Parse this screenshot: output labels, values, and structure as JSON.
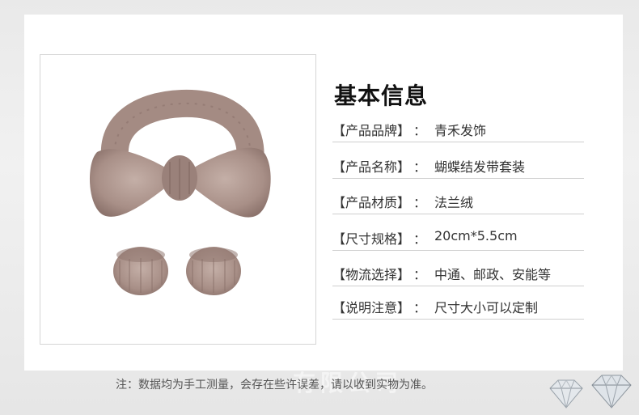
{
  "section_title": "基本信息",
  "specs": [
    {
      "key": "【产品品牌】",
      "sep": "：",
      "value": "青禾发饰"
    },
    {
      "key": "【产品名称】",
      "sep": "：",
      "value": "蝴蝶结发带套装"
    },
    {
      "key": "【产品材质】",
      "sep": "：",
      "value": "法兰绒"
    },
    {
      "key": "【尺寸规格】",
      "sep": "：",
      "value": "20cm*5.5cm"
    },
    {
      "key": "【物流选择】",
      "sep": "：",
      "value": "中通、邮政、安能等"
    },
    {
      "key": "【说明注意】",
      "sep": "：",
      "value": "尺寸大小可以定制"
    }
  ],
  "footer_note": "注：数据均为手工测量，会存在些许误差，请以收到实物为准。",
  "watermark_text": "有限公司",
  "colors": {
    "fabric": "#a89189",
    "fabric_dark": "#8b736c",
    "fabric_light": "#c3aea6"
  }
}
